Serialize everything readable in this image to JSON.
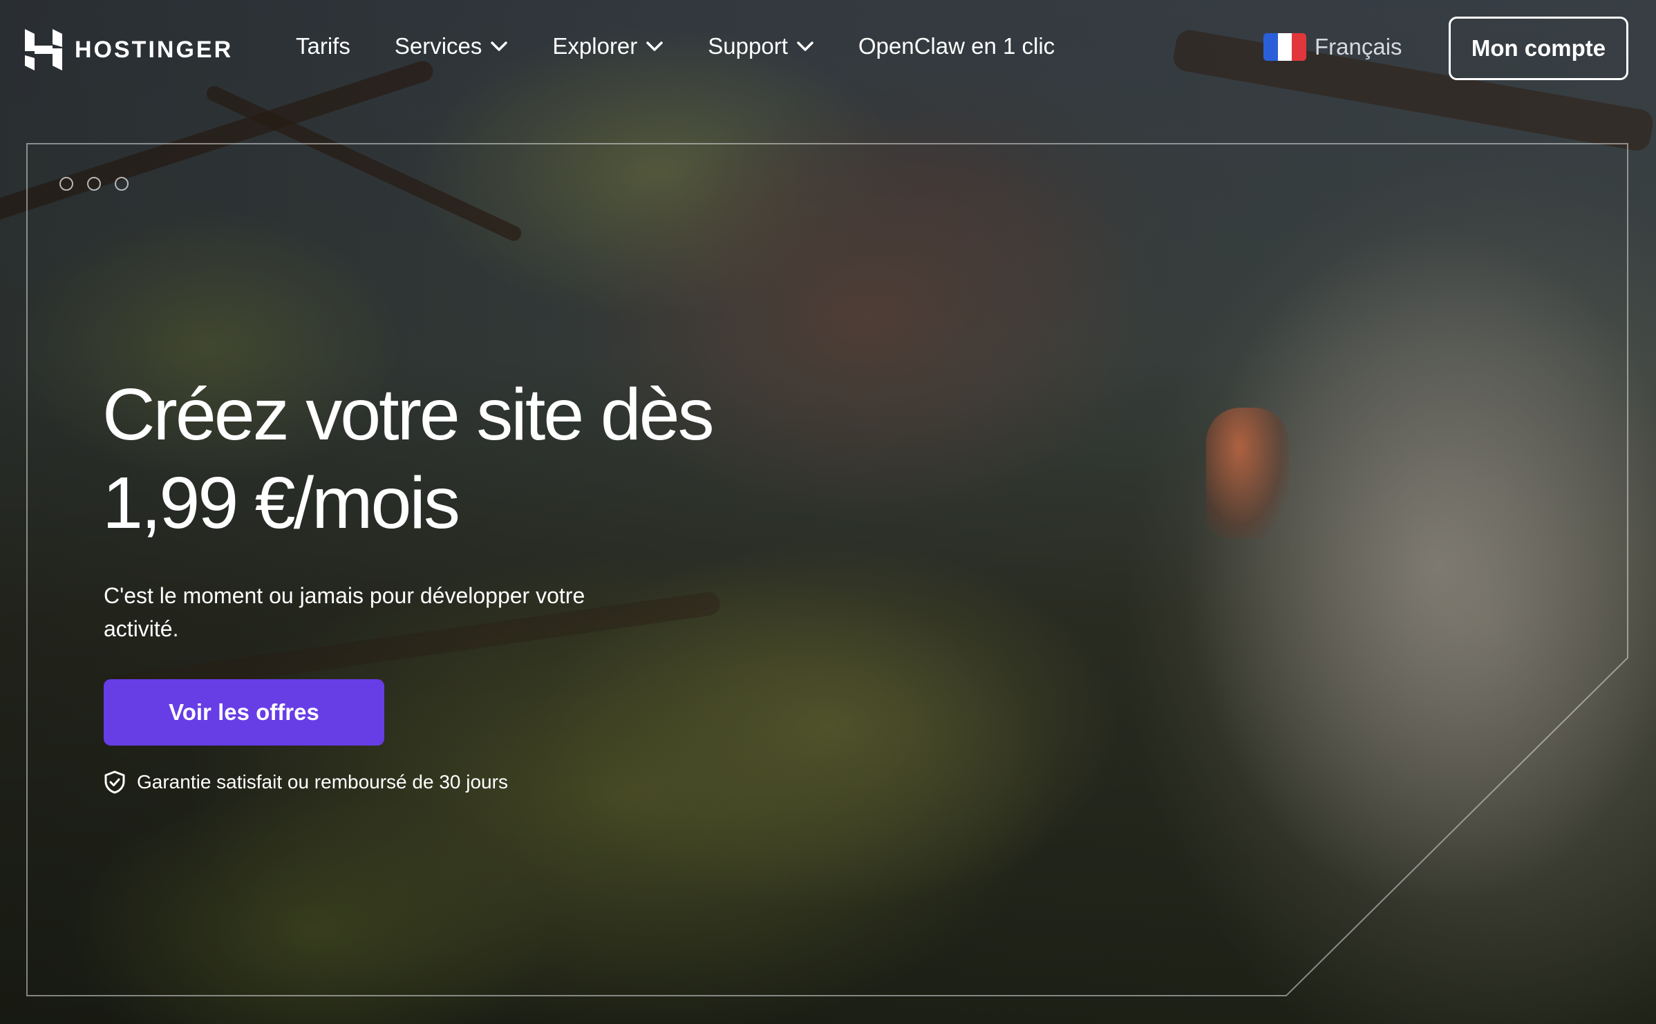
{
  "brand": {
    "name": "HOSTINGER",
    "icon": "hostinger-logo-icon"
  },
  "nav": {
    "items": [
      {
        "label": "Tarifs",
        "dropdown": false
      },
      {
        "label": "Services",
        "dropdown": true
      },
      {
        "label": "Explorer",
        "dropdown": true
      },
      {
        "label": "Support",
        "dropdown": true
      },
      {
        "label": "OpenClaw en 1 clic",
        "dropdown": false
      }
    ],
    "chevron_icon": "chevron-down-icon"
  },
  "language": {
    "label": "Français",
    "flag_icon": "france-flag-icon"
  },
  "account": {
    "label": "Mon compte"
  },
  "hero": {
    "headline_line1": "Créez votre site dès",
    "headline_line2": "1,99 €/mois",
    "subtitle": "C'est le moment ou jamais pour développer votre activité.",
    "cta_label": "Voir les offres",
    "guarantee_text": "Garantie satisfait ou remboursé de 30 jours",
    "guarantee_icon": "shield-check-icon",
    "carousel_dots": 3
  },
  "colors": {
    "accent": "#673de6",
    "text": "#ffffff",
    "flag_blue": "#2b5fd9",
    "flag_white": "#ffffff",
    "flag_red": "#e1373c"
  }
}
